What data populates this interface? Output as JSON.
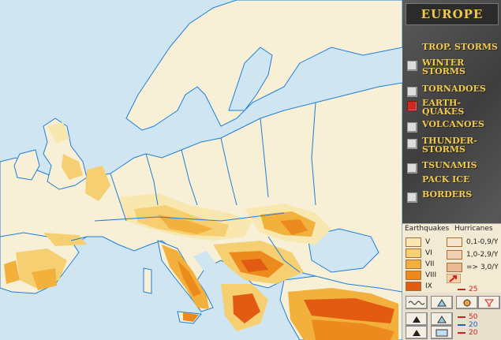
{
  "panel": {
    "title": "EUROPE",
    "menu": [
      {
        "label": "TROP. STORMS",
        "box": "none"
      },
      {
        "label": "WINTER\nSTORMS",
        "box": "off"
      },
      {
        "label": "TORNADOES",
        "box": "off"
      },
      {
        "label": "EARTH-\nQUAKES",
        "box": "active"
      },
      {
        "label": "VOLCANOES",
        "box": "off"
      },
      {
        "label": "THUNDER-\nSTORMS",
        "box": "off"
      },
      {
        "label": "TSUNAMIS",
        "box": "off"
      },
      {
        "label": "PACK ICE",
        "box": "none"
      },
      {
        "label": "BORDERS",
        "box": "off"
      }
    ]
  },
  "legend": {
    "earthquakes_header": "Earthquakes",
    "hurricanes_header": "Hurricanes",
    "intensity": [
      {
        "label": "V",
        "color": "#f9e7b0"
      },
      {
        "label": "VI",
        "color": "#f6cf72"
      },
      {
        "label": "VII",
        "color": "#f2b03c"
      },
      {
        "label": "VIII",
        "color": "#ec8a1e"
      },
      {
        "label": "IX",
        "color": "#e35a12"
      }
    ],
    "hurricanes": [
      {
        "label": "0,1-0,9/Y",
        "color": "#f6e4cc"
      },
      {
        "label": "1,0-2,9/Y",
        "color": "#f0d0b0"
      },
      {
        "label": "=> 3,0/Y",
        "color": "#e9b993"
      }
    ],
    "track_value": "25"
  },
  "scale": [
    {
      "label": "50",
      "color": "#d02020"
    },
    {
      "label": "20",
      "color": "#2060c0"
    },
    {
      "label": "20",
      "color": "#d02020"
    }
  ],
  "colors": {
    "sea": "#cfe6f2",
    "land": "#f7efd6",
    "border": "#1e7fd8",
    "panel_text": "#f2c94c",
    "active": "#d4281c"
  }
}
